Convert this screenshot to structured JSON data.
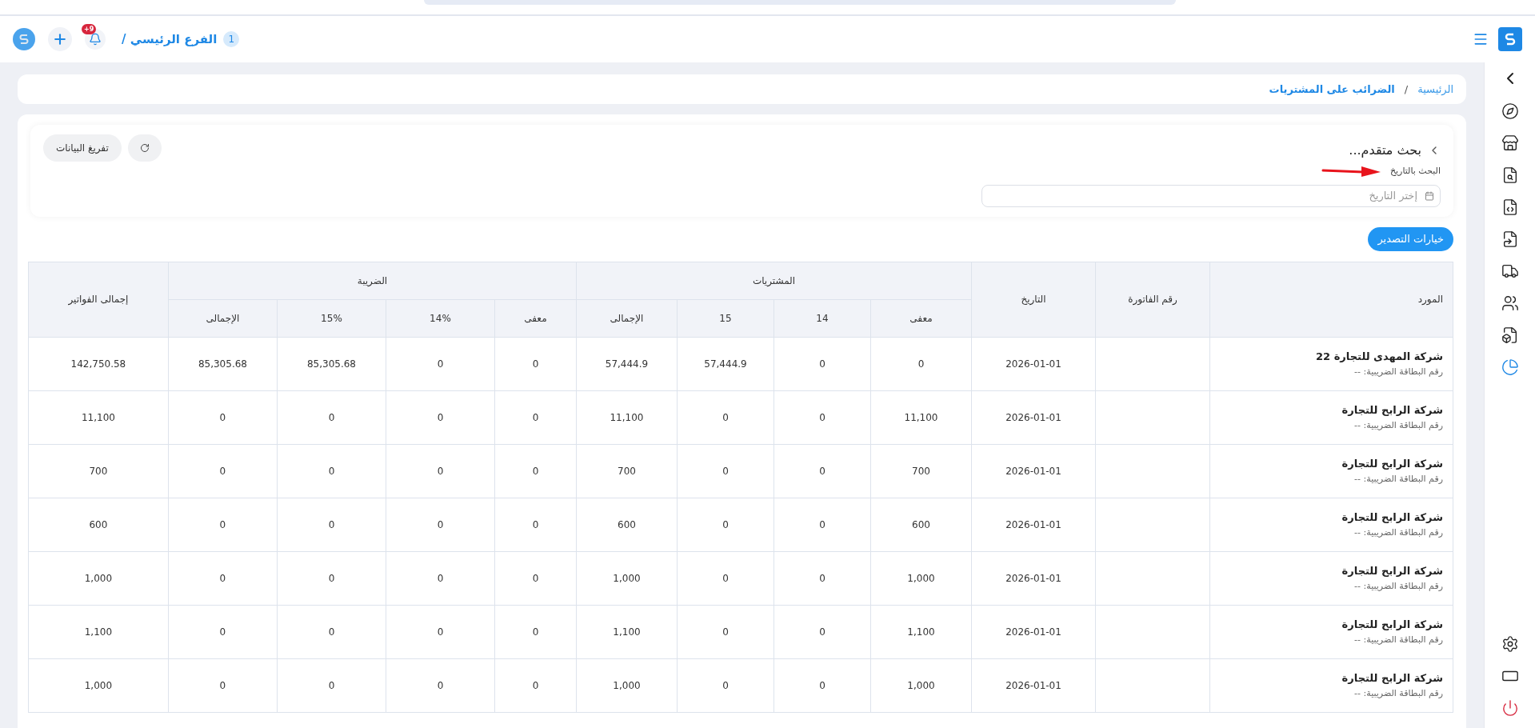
{
  "topbar": {
    "branch_count": "1",
    "branch": "الفرع الرئيسي /",
    "notifications": "+9"
  },
  "breadcrumb_separator": "/",
  "breadcrumb": [
    {
      "label": "الرئيسية",
      "current": false
    },
    {
      "label": "الضرائب على المشتريات",
      "current": true
    }
  ],
  "search": {
    "title": "بحث متقدم...",
    "expanded": false,
    "date_label": "البحث بالتاريخ",
    "date_placeholder": "إختر التاريخ",
    "clear_button": "تفريغ البيانات"
  },
  "export_button": "خيارات التصدير",
  "table": {
    "columns": {
      "supplier": "المورد",
      "invoice_no": "رقم الفاتورة",
      "date": "التاريخ",
      "purchases": "المشتريات",
      "tax": "الضريبة",
      "invoices_total": "إجمالى الفواتير",
      "purchases_sub": [
        "معفى",
        "14",
        "15",
        "الإجمالى"
      ],
      "tax_sub": [
        "معفى",
        "14%",
        "15%",
        "الإجمالى"
      ]
    },
    "rows": [
      {
        "supplier": "شركة المهدى للتجارة 22",
        "tax_card": "رقم البطاقة الضريبية: --",
        "date": "2026-01-01",
        "values": [
          "0",
          "0",
          "57,444.9",
          "57,444.9",
          "0",
          "0",
          "85,305.68",
          "85,305.68"
        ],
        "invoices_total": "142,750.58"
      },
      {
        "supplier": "شركة الرابح للتجارة",
        "tax_card": "رقم البطاقة الضريبية: --",
        "date": "2026-01-01",
        "values": [
          "11,100",
          "0",
          "0",
          "11,100",
          "0",
          "0",
          "0",
          "0"
        ],
        "invoices_total": "11,100"
      },
      {
        "supplier": "شركة الرابح للتجارة",
        "tax_card": "رقم البطاقة الضريبية: --",
        "date": "2026-01-01",
        "values": [
          "700",
          "0",
          "0",
          "700",
          "0",
          "0",
          "0",
          "0"
        ],
        "invoices_total": "700"
      },
      {
        "supplier": "شركة الرابح للتجارة",
        "tax_card": "رقم البطاقة الضريبية: --",
        "date": "2026-01-01",
        "values": [
          "600",
          "0",
          "0",
          "600",
          "0",
          "0",
          "0",
          "0"
        ],
        "invoices_total": "600"
      },
      {
        "supplier": "شركة الرابح للتجارة",
        "tax_card": "رقم البطاقة الضريبية: --",
        "date": "2026-01-01",
        "values": [
          "1,000",
          "0",
          "0",
          "1,000",
          "0",
          "0",
          "0",
          "0"
        ],
        "invoices_total": "1,000"
      },
      {
        "supplier": "شركة الرابح للتجارة",
        "tax_card": "رقم البطاقة الضريبية: --",
        "date": "2026-01-01",
        "values": [
          "1,100",
          "0",
          "0",
          "1,100",
          "0",
          "0",
          "0",
          "0"
        ],
        "invoices_total": "1,100"
      },
      {
        "supplier": "شركة الرابح للتجارة",
        "tax_card": "رقم البطاقة الضريبية: --",
        "date": "2026-01-01",
        "values": [
          "1,000",
          "0",
          "0",
          "1,000",
          "0",
          "0",
          "0",
          "0"
        ],
        "invoices_total": "1,000"
      }
    ]
  },
  "sidebar": {
    "items": [
      {
        "selected": false
      },
      {
        "selected": false
      },
      {
        "selected": false
      },
      {
        "selected": false
      },
      {
        "selected": false
      },
      {
        "selected": false
      },
      {
        "selected": false
      },
      {
        "selected": false
      },
      {
        "selected": true
      }
    ]
  }
}
